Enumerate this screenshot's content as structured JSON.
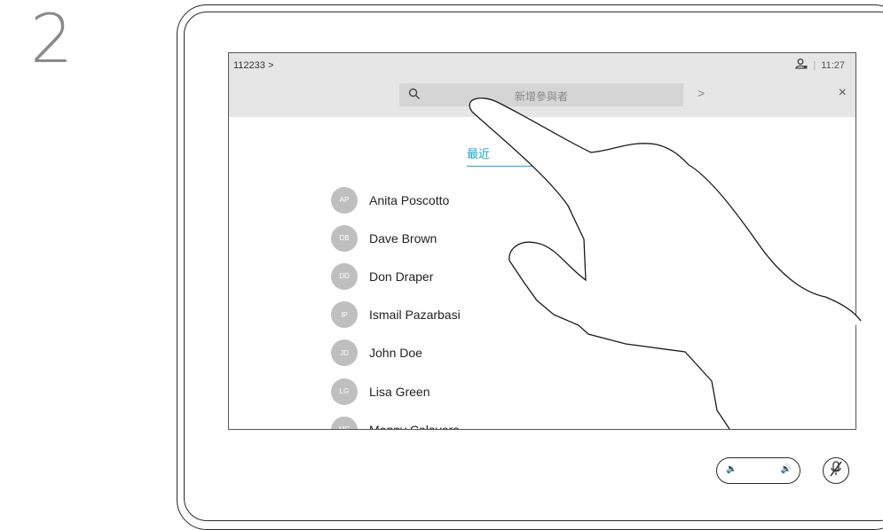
{
  "step": {
    "number": "2"
  },
  "screen": {
    "call_id": "112233 >",
    "time": "11:27",
    "separator": "|",
    "search": {
      "placeholder": "新增參與者"
    },
    "next_arrow": ">",
    "close": "×",
    "tab": {
      "label": "最近"
    },
    "contacts": [
      {
        "initials": "AP",
        "name": "Anita Poscotto"
      },
      {
        "initials": "DB",
        "name": "Dave Brown"
      },
      {
        "initials": "DD",
        "name": "Don Draper"
      },
      {
        "initials": "IP",
        "name": "Ismail Pazarbasi"
      },
      {
        "initials": "JD",
        "name": "John Doe"
      },
      {
        "initials": "LG",
        "name": "Lisa Green"
      },
      {
        "initials": "MC",
        "name": "Manny Calavera"
      }
    ]
  },
  "controls": {
    "volume_down": "🔈",
    "volume_up": "🔊"
  },
  "colors": {
    "accent": "#1aa5d6",
    "avatar": "#bfbfbf",
    "topbar": "#e6e6e6"
  },
  "icons": [
    "search-icon",
    "user-icon",
    "close-icon",
    "chevron-right-icon",
    "volume-down-icon",
    "volume-up-icon",
    "mute-icon",
    "hand-icon"
  ]
}
